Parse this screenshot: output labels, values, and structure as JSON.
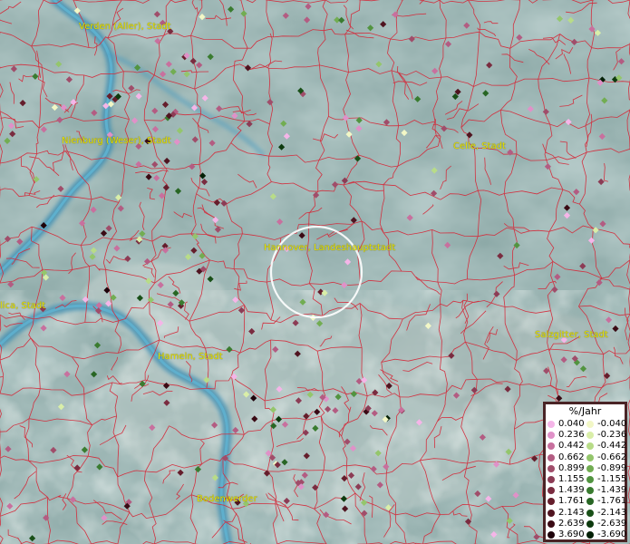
{
  "places": [
    {
      "id": "verden",
      "name": "Verden (Aller), Stadt"
    },
    {
      "id": "nienburg",
      "name": "Nienburg (Weser), Stadt"
    },
    {
      "id": "celle",
      "name": "Celle, Stadt"
    },
    {
      "id": "hannover",
      "name": "Hannover, Landeshauptstadt"
    },
    {
      "id": "minden",
      "name": "lica, Stadt"
    },
    {
      "id": "hameln",
      "name": "Hameln, Stadt"
    },
    {
      "id": "salzgitter",
      "name": "Salzgitter, Stadt"
    },
    {
      "id": "bodenwerder",
      "name": "Bodenwerder"
    }
  ],
  "legend": {
    "title": "%/Jahr",
    "positive": [
      {
        "label": "0.040",
        "color": "#f5b5e8"
      },
      {
        "label": "0.236",
        "color": "#e091c8"
      },
      {
        "label": "0.442",
        "color": "#c8709e"
      },
      {
        "label": "0.662",
        "color": "#b35c82"
      },
      {
        "label": "0.899",
        "color": "#a04d6a"
      },
      {
        "label": "1.155",
        "color": "#8c3c55"
      },
      {
        "label": "1.439",
        "color": "#7a2c40"
      },
      {
        "label": "1.761",
        "color": "#651e2c"
      },
      {
        "label": "2.143",
        "color": "#501420"
      },
      {
        "label": "2.639",
        "color": "#3a0a14"
      },
      {
        "label": "3.690",
        "color": "#1e020a"
      }
    ],
    "negative": [
      {
        "label": "-0.040",
        "color": "#f2f7c6"
      },
      {
        "label": "-0.236",
        "color": "#d9eea8"
      },
      {
        "label": "-0.442",
        "color": "#b8dc88"
      },
      {
        "label": "-0.662",
        "color": "#94c66c"
      },
      {
        "label": "-0.899",
        "color": "#72ad52"
      },
      {
        "label": "-1.155",
        "color": "#529440"
      },
      {
        "label": "-1.439",
        "color": "#3a7c30"
      },
      {
        "label": "-1.761",
        "color": "#286624"
      },
      {
        "label": "-2.143",
        "color": "#195018"
      },
      {
        "label": "-2.639",
        "color": "#0d3a0e"
      },
      {
        "label": "-3.690",
        "color": "#042006"
      }
    ]
  },
  "colors": {
    "border": "#d42a3a",
    "river": "#4fa4c4",
    "terrain": "#7d9c9a"
  }
}
